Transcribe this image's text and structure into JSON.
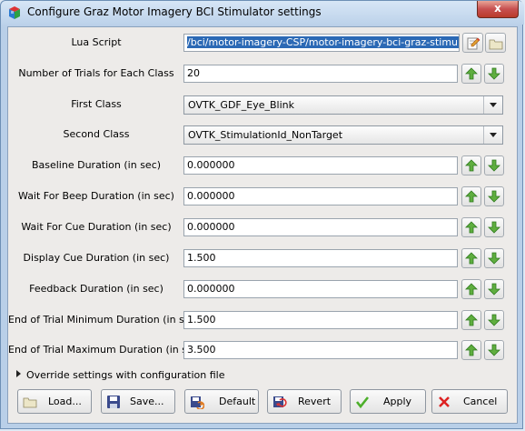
{
  "window": {
    "title": "Configure Graz Motor Imagery BCI Stimulator settings",
    "close_label": "x"
  },
  "fields": [
    {
      "label": "Lua Script",
      "value": "/bci/motor-imagery-CSP/motor-imagery-bci-graz-stimulator.lua",
      "type": "file"
    },
    {
      "label": "Number of Trials for Each Class",
      "value": "20",
      "type": "spin"
    },
    {
      "label": "First Class",
      "value": "OVTK_GDF_Eye_Blink",
      "type": "combo"
    },
    {
      "label": "Second Class",
      "value": "OVTK_StimulationId_NonTarget",
      "type": "combo"
    },
    {
      "label": "Baseline Duration (in sec)",
      "value": "0.000000",
      "type": "spin"
    },
    {
      "label": "Wait For Beep Duration (in sec)",
      "value": "0.000000",
      "type": "spin"
    },
    {
      "label": "Wait For Cue Duration (in sec)",
      "value": "0.000000",
      "type": "spin"
    },
    {
      "label": "Display Cue Duration (in sec)",
      "value": "1.500",
      "type": "spin"
    },
    {
      "label": "Feedback Duration (in sec)",
      "value": "0.000000",
      "type": "spin"
    },
    {
      "label": "End of Trial Minimum Duration (in sec)",
      "value": "1.500",
      "type": "spin"
    },
    {
      "label": "End of Trial Maximum Duration (in sec)",
      "value": "3.500",
      "type": "spin"
    }
  ],
  "override": {
    "label": "Override settings with configuration file"
  },
  "buttons": {
    "load": "Load...",
    "save": "Save...",
    "default": "Default",
    "revert": "Revert",
    "apply": "Apply",
    "cancel": "Cancel"
  },
  "colors": {
    "accent_green": "#5fae3f",
    "selection_blue": "#2b69b5",
    "close_red": "#c75050"
  }
}
